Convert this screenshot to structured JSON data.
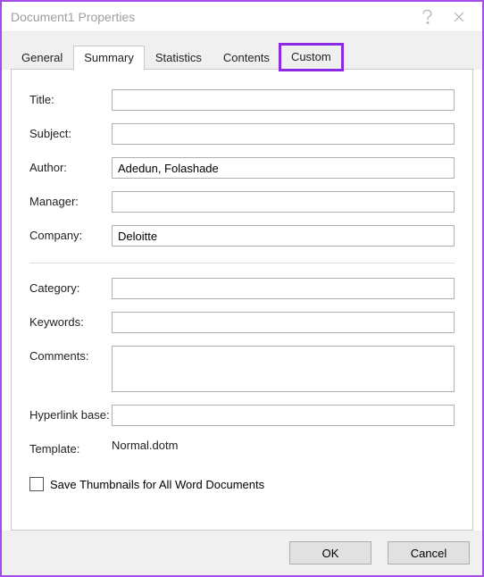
{
  "window": {
    "title": "Document1 Properties"
  },
  "tabs": {
    "general": "General",
    "summary": "Summary",
    "statistics": "Statistics",
    "contents": "Contents",
    "custom": "Custom"
  },
  "form": {
    "title": {
      "label": "Title:",
      "value": ""
    },
    "subject": {
      "label": "Subject:",
      "value": ""
    },
    "author": {
      "label": "Author:",
      "value": "Adedun, Folashade"
    },
    "manager": {
      "label": "Manager:",
      "value": ""
    },
    "company": {
      "label": "Company:",
      "value": "Deloitte"
    },
    "category": {
      "label": "Category:",
      "value": ""
    },
    "keywords": {
      "label": "Keywords:",
      "value": ""
    },
    "comments": {
      "label": "Comments:",
      "value": ""
    },
    "hyperlink_base": {
      "label": "Hyperlink base:",
      "value": ""
    },
    "template": {
      "label": "Template:",
      "value": "Normal.dotm"
    }
  },
  "checkbox": {
    "save_thumbnails": "Save Thumbnails for All Word Documents"
  },
  "buttons": {
    "ok": "OK",
    "cancel": "Cancel"
  }
}
